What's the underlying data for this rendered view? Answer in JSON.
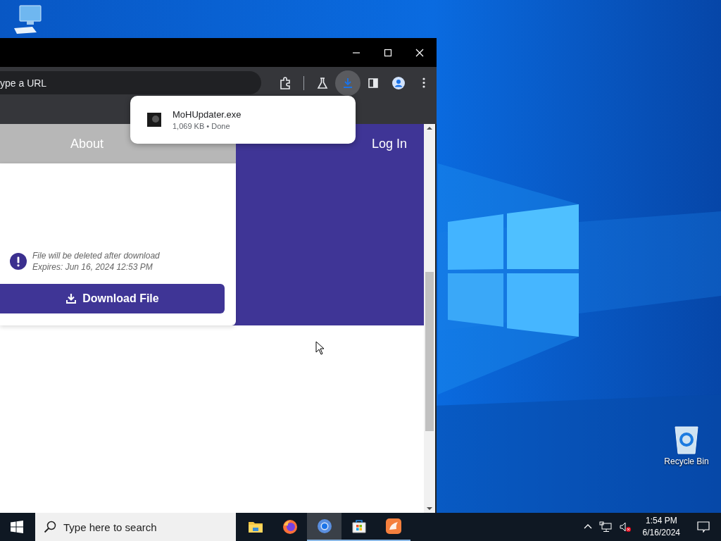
{
  "desktop": {
    "recycle_bin_label": "Recycle Bin"
  },
  "browser": {
    "omnibox": {
      "placeholder": "ype a URL"
    },
    "toolbar": [
      {
        "kind": "extensions",
        "selected": false
      },
      {
        "kind": "labs",
        "selected": false
      },
      {
        "kind": "download",
        "selected": true
      },
      {
        "kind": "sidebar",
        "selected": false
      },
      {
        "kind": "profile",
        "selected": false
      },
      {
        "kind": "menu",
        "selected": false
      }
    ],
    "download_popup": {
      "file_name": "MoHUpdater.exe",
      "details": "1,069 KB • Done"
    },
    "page": {
      "nav": [
        {
          "label": "About"
        },
        {
          "label": "Log In"
        }
      ],
      "notice": [
        "File will be deleted after download",
        "Expires: Jun 16, 2024 12:53 PM"
      ],
      "download_button": "Download File"
    }
  },
  "taskbar": {
    "search_placeholder": "Type here to search",
    "apps": [
      {
        "kind": "explorer",
        "selected": false,
        "running": false
      },
      {
        "kind": "firefox",
        "selected": false,
        "running": false
      },
      {
        "kind": "chrome",
        "selected": true,
        "running": true
      },
      {
        "kind": "store",
        "selected": false,
        "running": true
      },
      {
        "kind": "app",
        "selected": false,
        "running": true
      }
    ],
    "time": "1:54 PM",
    "date": "6/16/2024"
  }
}
